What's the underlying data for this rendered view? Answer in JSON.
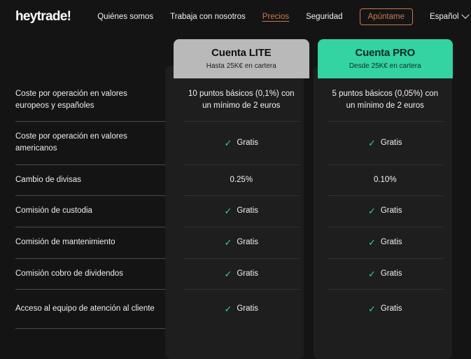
{
  "brand": {
    "logo_text": "heytrade!"
  },
  "nav": {
    "links": [
      {
        "label": "Quiénes somos",
        "active": false
      },
      {
        "label": "Trabaja con nosotros",
        "active": false
      },
      {
        "label": "Precios",
        "active": true
      },
      {
        "label": "Seguridad",
        "active": false
      }
    ],
    "cta_label": "Apúntame",
    "language_label": "Español",
    "chevron_icon": "chevron-down-icon",
    "accent_color": "#c8794f"
  },
  "pricing": {
    "plans": [
      {
        "id": "lite",
        "title": "Cuenta LITE",
        "subtitle": "Hasta 25K€ en cartera",
        "header_color": "#b9b9b9"
      },
      {
        "id": "pro",
        "title": "Cuenta PRO",
        "subtitle": "Desde 25K€ en cartera",
        "header_color": "#33d3a2"
      }
    ],
    "check_icon": "check-icon",
    "check_color": "#2fd39f",
    "free_label": "Gratis",
    "rows": [
      {
        "feature": "Coste por operación en valores europeos y españoles",
        "lite": {
          "text": "10 puntos básicos (0,1%) con un mínimo de 2 euros",
          "check": false
        },
        "pro": {
          "text": "5 puntos básicos (0,05%) con un mínimo de 2 euros",
          "check": false
        }
      },
      {
        "feature": "Coste por operación en valores americanos",
        "lite": {
          "text": "Gratis",
          "check": true
        },
        "pro": {
          "text": "Gratis",
          "check": true
        }
      },
      {
        "feature": "Cambio de divisas",
        "lite": {
          "text": "0.25%",
          "check": false
        },
        "pro": {
          "text": "0.10%",
          "check": false
        }
      },
      {
        "feature": "Comisión de custodia",
        "lite": {
          "text": "Gratis",
          "check": true
        },
        "pro": {
          "text": "Gratis",
          "check": true
        }
      },
      {
        "feature": "Comisión de mantenimiento",
        "lite": {
          "text": "Gratis",
          "check": true
        },
        "pro": {
          "text": "Gratis",
          "check": true
        }
      },
      {
        "feature": "Comisión cobro de dividendos",
        "lite": {
          "text": "Gratis",
          "check": true
        },
        "pro": {
          "text": "Gratis",
          "check": true
        }
      },
      {
        "feature": "Acceso al equipo de atención al cliente",
        "lite": {
          "text": "Gratis",
          "check": true
        },
        "pro": {
          "text": "Gratis",
          "check": true
        }
      }
    ]
  }
}
